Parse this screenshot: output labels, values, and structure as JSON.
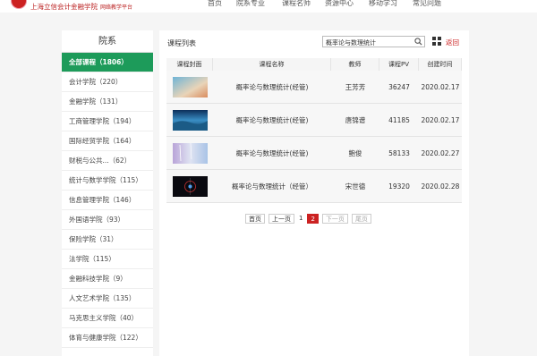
{
  "header": {
    "logo_text": "上海立信会计金融学院",
    "logo_subtitle": "网络教学平台",
    "nav": [
      "首页",
      "院系专业",
      "课程名师",
      "资源中心",
      "移动学习",
      "常见问题"
    ]
  },
  "sidebar": {
    "title": "院系",
    "items": [
      {
        "label": "全部课程（1806）",
        "active": true
      },
      {
        "label": "会计学院（220）"
      },
      {
        "label": "金融学院（131）"
      },
      {
        "label": "工商管理学院（194）"
      },
      {
        "label": "国际经贸学院（164）"
      },
      {
        "label": "财税与公共...（62）"
      },
      {
        "label": "统计与数学学院（115）"
      },
      {
        "label": "信息管理学院（146）"
      },
      {
        "label": "外国语学院（93）"
      },
      {
        "label": "保险学院（31）"
      },
      {
        "label": "法学院（115）"
      },
      {
        "label": "金融科技学院（9）"
      },
      {
        "label": "人文艺术学院（135）"
      },
      {
        "label": "马克思主义学院（40）"
      },
      {
        "label": "体育与健康学院（122）"
      }
    ]
  },
  "main": {
    "title": "课程列表",
    "search_value": "概率论与数理统计",
    "back_label": "返回",
    "columns": [
      "课程封面",
      "课程名称",
      "教师",
      "课程PV",
      "创建时间"
    ],
    "rows": [
      {
        "name": "概率论与数理统计(经管)",
        "teacher": "王芳芳",
        "pv": "36247",
        "date": "2020.02.17"
      },
      {
        "name": "概率论与数理统计(经管)",
        "teacher": "唐锦谱",
        "pv": "41185",
        "date": "2020.02.17"
      },
      {
        "name": "概率论与数理统计(经管)",
        "teacher": "鲍俊",
        "pv": "58133",
        "date": "2020.02.27"
      },
      {
        "name": "概率论与数理统计（经管）",
        "teacher": "宋世德",
        "pv": "19320",
        "date": "2020.02.28"
      }
    ],
    "pager": {
      "first": "首页",
      "prev": "上一页",
      "page1": "1",
      "page2": "2",
      "next": "下一页",
      "last": "尾页"
    }
  },
  "colors": {
    "accent_green": "#1d9b5a",
    "accent_red": "#c22222"
  }
}
